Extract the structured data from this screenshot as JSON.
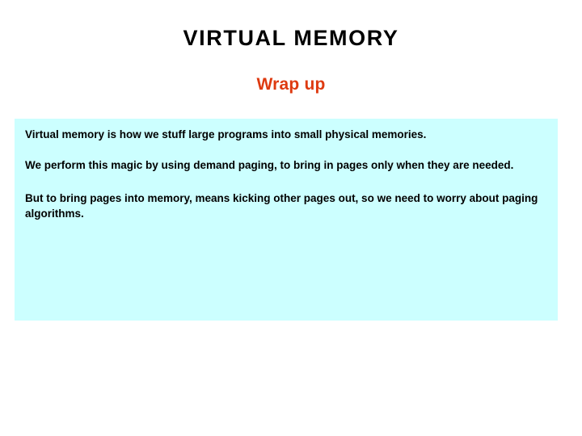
{
  "slide": {
    "title": "VIRTUAL MEMORY",
    "subtitle": "Wrap up",
    "colors": {
      "title_color": "#000000",
      "subtitle_color": "#DE3A10",
      "box_background": "#CCFFFF",
      "body_text_color": "#000000",
      "page_background": "#FFFFFF"
    },
    "content_box": {
      "paragraphs": [
        "Virtual memory is how we stuff large programs into small physical memories.",
        "We perform this magic by using demand paging, to bring in pages only when they are needed.",
        "But to bring pages into memory, means kicking other pages out, so we need to worry about paging algorithms."
      ]
    }
  }
}
